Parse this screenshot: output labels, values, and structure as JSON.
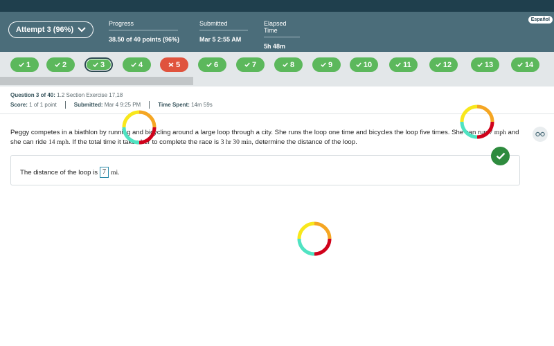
{
  "header": {
    "attempt_label": "Attempt 3 (96%)",
    "language_button": "Español",
    "stats": [
      {
        "label": "Progress",
        "value": "38.50 of 40 points (96%)"
      },
      {
        "label": "Submitted",
        "value": "Mar 5 2:55 AM"
      },
      {
        "label": "Elapsed Time",
        "value": "5h 48m"
      }
    ]
  },
  "questions": [
    {
      "num": "1",
      "status": "correct"
    },
    {
      "num": "2",
      "status": "correct"
    },
    {
      "num": "3",
      "status": "correct-current"
    },
    {
      "num": "4",
      "status": "correct"
    },
    {
      "num": "5",
      "status": "wrong"
    },
    {
      "num": "6",
      "status": "correct"
    },
    {
      "num": "7",
      "status": "correct"
    },
    {
      "num": "8",
      "status": "correct"
    },
    {
      "num": "9",
      "status": "correct"
    },
    {
      "num": "10",
      "status": "correct"
    },
    {
      "num": "11",
      "status": "correct"
    },
    {
      "num": "12",
      "status": "correct"
    },
    {
      "num": "13",
      "status": "correct"
    },
    {
      "num": "14",
      "status": "correct"
    }
  ],
  "meta": {
    "question_label": "Question 3 of 40:",
    "question_value": "1.2 Section Exercise 17,18",
    "score_label": "Score:",
    "score_value": "1 of 1 point",
    "submitted_label": "Submitted:",
    "submitted_value": "Mar 4 9:25 PM",
    "time_label": "Time Spent:",
    "time_value": "14m 59s"
  },
  "problem": {
    "text_1": "Peggy competes in a biathlon by running and bicycling around a large loop through a city. She runs the loop one time and bicycles the loop five times. She can run ",
    "run_speed": "7 mph",
    "text_2": " and she can ride ",
    "ride_speed": "14 mph",
    "text_3": ". If the total time it takes her to complete the race is ",
    "total_time": "3 hr 30 min",
    "text_4": ", determine the distance of the loop."
  },
  "answer": {
    "prefix": "The distance of the loop is",
    "value": "7",
    "unit": "mi."
  },
  "colors": {
    "header_bg": "#4b6d7a",
    "correct": "#5cb85c",
    "wrong": "#e0533d",
    "check_circle": "#2e8b3e"
  }
}
